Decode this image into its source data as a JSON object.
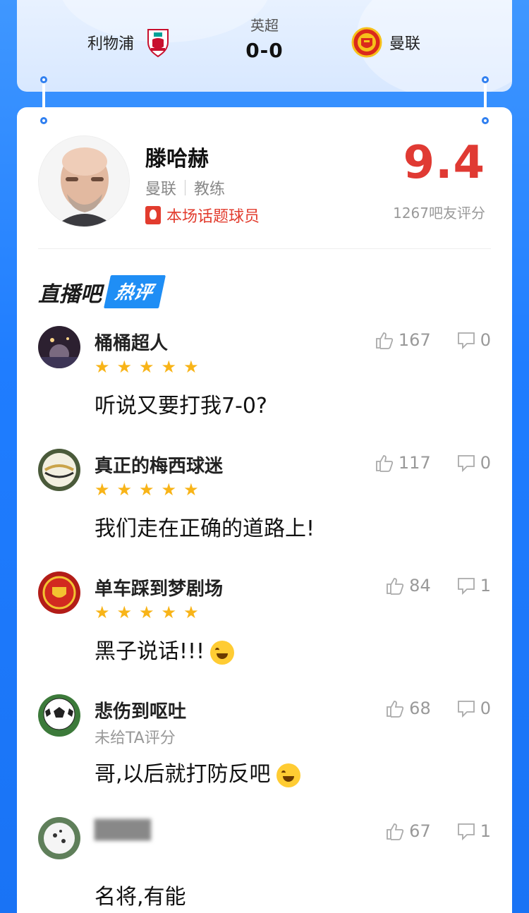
{
  "match": {
    "home_team": "利物浦",
    "away_team": "曼联",
    "league": "英超",
    "score": "0-0"
  },
  "player": {
    "name": "滕哈赫",
    "team": "曼联",
    "role": "教练",
    "topic_label": "本场话题球员",
    "rating": "9.4",
    "rating_count": "1267吧友评分"
  },
  "section": {
    "title_main": "直播吧",
    "title_tag": "热评"
  },
  "comments": [
    {
      "user": "桶桶超人",
      "stars": 5,
      "text": "听说又要打我7-0?",
      "likes": "167",
      "replies": "0"
    },
    {
      "user": "真正的梅西球迷",
      "stars": 5,
      "text": "我们走在正确的道路上!",
      "likes": "117",
      "replies": "0"
    },
    {
      "user": "单车踩到梦剧场",
      "stars": 5,
      "text": "黑子说话!!!",
      "likes": "84",
      "replies": "1"
    },
    {
      "user": "悲伤到呕吐",
      "rating_note": "未给TA评分",
      "text": "哥,以后就打防反吧",
      "likes": "68",
      "replies": "0"
    },
    {
      "user": "",
      "text": "名将,有能",
      "likes": "67",
      "replies": "1"
    }
  ],
  "colors": {
    "accent": "#1f8ef5",
    "rating_red": "#e03a33",
    "star": "#f8b418"
  }
}
